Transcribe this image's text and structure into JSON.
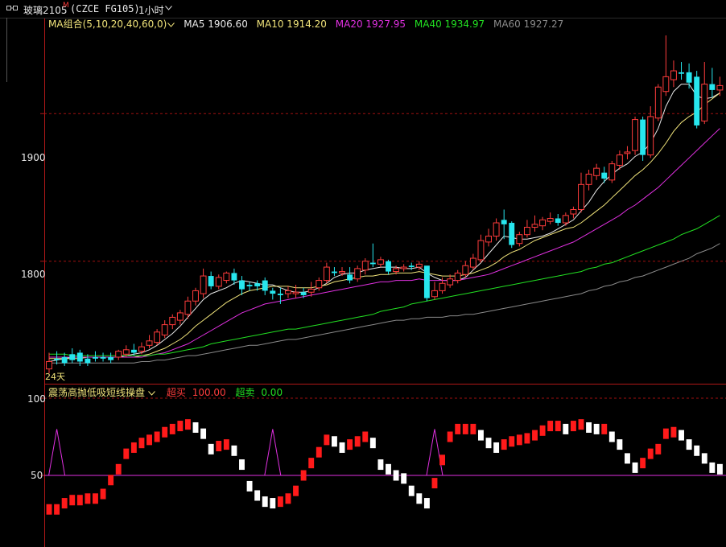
{
  "window": {
    "symbol": "玻璃2105",
    "flag": "M",
    "code": "(CZCE FG105)",
    "period": "1小时"
  },
  "ma_legend": {
    "group_label": "MA组合(5,10,20,40,60,0)",
    "items": [
      {
        "label": "MA5 1906.60",
        "color": "#e8e8e8"
      },
      {
        "label": "MA10 1914.20",
        "color": "#f0e37a"
      },
      {
        "label": "MA20 1927.95",
        "color": "#e030e0"
      },
      {
        "label": "MA40 1934.97",
        "color": "#22e022"
      },
      {
        "label": "MA60 1927.27",
        "color": "#8a8a8a"
      }
    ]
  },
  "price_axis": {
    "labels": [
      "1900",
      "1800"
    ]
  },
  "days_label": "24天",
  "indicator": {
    "name": "震荡高抛低吸短线操盘",
    "overbuy_label": "超买",
    "overbuy_value": "100.00",
    "oversell_label": "超卖",
    "oversell_value": "0.00",
    "axis_labels": [
      "100",
      "50"
    ]
  },
  "colors": {
    "up": "#ff3c3c",
    "down": "#27e6ee",
    "grid": "#a01010",
    "bg": "#000000"
  },
  "chart_data": {
    "type": "candlestick",
    "y_range": [
      1717,
      1965
    ],
    "candles": [
      [
        1727,
        1738,
        1732,
        1724
      ],
      [
        1734,
        1739,
        1733,
        1730
      ],
      [
        1735,
        1738,
        1731,
        1729
      ],
      [
        1737,
        1741,
        1733,
        1731
      ],
      [
        1738,
        1740,
        1732,
        1729
      ],
      [
        1734,
        1737,
        1731,
        1729
      ],
      [
        1735,
        1739,
        1734,
        1732
      ],
      [
        1735,
        1738,
        1734,
        1732
      ],
      [
        1735,
        1738,
        1733,
        1731
      ],
      [
        1735,
        1740,
        1739,
        1733
      ],
      [
        1737,
        1743,
        1740,
        1735
      ],
      [
        1740,
        1744,
        1738,
        1736
      ],
      [
        1739,
        1745,
        1742,
        1737
      ],
      [
        1743,
        1750,
        1746,
        1741
      ],
      [
        1745,
        1754,
        1752,
        1743
      ],
      [
        1750,
        1760,
        1757,
        1748
      ],
      [
        1757,
        1764,
        1762,
        1754
      ],
      [
        1760,
        1767,
        1765,
        1757
      ],
      [
        1764,
        1776,
        1773,
        1761
      ],
      [
        1773,
        1782,
        1780,
        1770
      ],
      [
        1778,
        1795,
        1790,
        1775
      ],
      [
        1790,
        1793,
        1783,
        1781
      ],
      [
        1783,
        1791,
        1789,
        1781
      ],
      [
        1787,
        1793,
        1792,
        1785
      ],
      [
        1792,
        1795,
        1787,
        1784
      ],
      [
        1787,
        1790,
        1781,
        1777
      ],
      [
        1784,
        1786,
        1783,
        1780
      ],
      [
        1785,
        1787,
        1783,
        1780
      ],
      [
        1787,
        1789,
        1780,
        1777
      ],
      [
        1780,
        1782,
        1778,
        1774
      ],
      [
        1778,
        1782,
        1777,
        1771
      ],
      [
        1778,
        1783,
        1780,
        1775
      ],
      [
        1778,
        1784,
        1779,
        1775
      ],
      [
        1779,
        1782,
        1777,
        1775
      ],
      [
        1779,
        1786,
        1781,
        1776
      ],
      [
        1782,
        1789,
        1787,
        1780
      ],
      [
        1787,
        1799,
        1796,
        1785
      ],
      [
        1793,
        1796,
        1792,
        1790
      ],
      [
        1792,
        1796,
        1793,
        1790
      ],
      [
        1791,
        1796,
        1787,
        1785
      ],
      [
        1788,
        1797,
        1795,
        1786
      ],
      [
        1794,
        1802,
        1800,
        1791
      ],
      [
        1799,
        1812,
        1798,
        1796
      ],
      [
        1798,
        1803,
        1801,
        1796
      ],
      [
        1800,
        1801,
        1793,
        1791
      ],
      [
        1793,
        1797,
        1795,
        1791
      ],
      [
        1795,
        1798,
        1796,
        1793
      ],
      [
        1797,
        1799,
        1796,
        1794
      ],
      [
        1796,
        1800,
        1798,
        1794
      ],
      [
        1797,
        1796,
        1775,
        1773
      ],
      [
        1776,
        1786,
        1780,
        1774
      ],
      [
        1780,
        1789,
        1785,
        1778
      ],
      [
        1784,
        1791,
        1788,
        1782
      ],
      [
        1787,
        1794,
        1792,
        1785
      ],
      [
        1791,
        1800,
        1797,
        1789
      ],
      [
        1796,
        1805,
        1802,
        1794
      ],
      [
        1801,
        1818,
        1814,
        1799
      ],
      [
        1813,
        1822,
        1817,
        1810
      ],
      [
        1817,
        1829,
        1826,
        1814
      ],
      [
        1828,
        1835,
        1825,
        1815
      ],
      [
        1826,
        1827,
        1811,
        1809
      ],
      [
        1812,
        1820,
        1818,
        1810
      ],
      [
        1818,
        1828,
        1823,
        1816
      ],
      [
        1823,
        1831,
        1825,
        1820
      ],
      [
        1824,
        1830,
        1828,
        1821
      ],
      [
        1827,
        1833,
        1829,
        1825
      ],
      [
        1829,
        1832,
        1826,
        1824
      ],
      [
        1826,
        1833,
        1831,
        1824
      ],
      [
        1832,
        1837,
        1835,
        1829
      ],
      [
        1835,
        1860,
        1852,
        1833
      ],
      [
        1852,
        1862,
        1859,
        1848
      ],
      [
        1858,
        1866,
        1863,
        1855
      ],
      [
        1860,
        1864,
        1856,
        1853
      ],
      [
        1855,
        1868,
        1866,
        1853
      ],
      [
        1865,
        1875,
        1872,
        1862
      ],
      [
        1873,
        1878,
        1874,
        1869
      ],
      [
        1875,
        1898,
        1896,
        1872
      ],
      [
        1896,
        1898,
        1872,
        1868
      ],
      [
        1872,
        1905,
        1898,
        1870
      ],
      [
        1897,
        1920,
        1918,
        1895
      ],
      [
        1915,
        1953,
        1925,
        1912
      ],
      [
        1923,
        1936,
        1929,
        1918
      ],
      [
        1928,
        1935,
        1927,
        1923
      ],
      [
        1928,
        1934,
        1921,
        1917
      ],
      [
        1925,
        1929,
        1892,
        1890
      ],
      [
        1895,
        1935,
        1920,
        1893
      ],
      [
        1920,
        1931,
        1916,
        1911
      ],
      [
        1916,
        1925,
        1919,
        1912
      ]
    ],
    "ma": {
      "MA5": [
        1732,
        1733,
        1734,
        1735,
        1735,
        1735,
        1735,
        1735,
        1735,
        1735,
        1736,
        1737,
        1738,
        1740,
        1743,
        1747,
        1751,
        1756,
        1762,
        1768,
        1774,
        1778,
        1780,
        1782,
        1785,
        1787,
        1786,
        1785,
        1784,
        1784,
        1782,
        1780,
        1779,
        1779,
        1780,
        1782,
        1785,
        1789,
        1791,
        1792,
        1792,
        1794,
        1795,
        1796,
        1796,
        1796,
        1795,
        1795,
        1796,
        1792,
        1789,
        1787,
        1787,
        1787,
        1789,
        1794,
        1799,
        1805,
        1811,
        1817,
        1816,
        1815,
        1815,
        1816,
        1817,
        1819,
        1822,
        1825,
        1828,
        1834,
        1840,
        1848,
        1854,
        1859,
        1863,
        1866,
        1871,
        1874,
        1880,
        1890,
        1905,
        1915,
        1920,
        1920,
        1912,
        1910,
        1911,
        1914
      ],
      "MA10": [
        1734,
        1734,
        1734,
        1734,
        1734,
        1735,
        1735,
        1735,
        1735,
        1735,
        1735,
        1735,
        1736,
        1737,
        1739,
        1741,
        1744,
        1747,
        1751,
        1756,
        1760,
        1764,
        1768,
        1772,
        1775,
        1778,
        1780,
        1781,
        1782,
        1783,
        1783,
        1783,
        1782,
        1782,
        1782,
        1783,
        1784,
        1786,
        1787,
        1788,
        1789,
        1790,
        1790,
        1791,
        1791,
        1792,
        1792,
        1792,
        1793,
        1792,
        1791,
        1790,
        1790,
        1790,
        1791,
        1792,
        1794,
        1796,
        1799,
        1803,
        1806,
        1808,
        1811,
        1814,
        1816,
        1818,
        1820,
        1822,
        1823,
        1826,
        1830,
        1834,
        1838,
        1843,
        1848,
        1853,
        1858,
        1862,
        1867,
        1873,
        1880,
        1888,
        1894,
        1898,
        1901,
        1906,
        1910,
        1914
      ],
      "MA20": [
        1735,
        1735,
        1735,
        1735,
        1735,
        1735,
        1735,
        1735,
        1735,
        1735,
        1735,
        1735,
        1735,
        1736,
        1737,
        1738,
        1740,
        1742,
        1744,
        1747,
        1750,
        1753,
        1756,
        1759,
        1762,
        1765,
        1767,
        1769,
        1771,
        1772,
        1773,
        1774,
        1775,
        1776,
        1777,
        1778,
        1779,
        1780,
        1781,
        1782,
        1783,
        1784,
        1785,
        1786,
        1786,
        1787,
        1787,
        1787,
        1788,
        1787,
        1787,
        1787,
        1787,
        1787,
        1788,
        1789,
        1790,
        1791,
        1793,
        1795,
        1797,
        1799,
        1801,
        1803,
        1805,
        1807,
        1809,
        1811,
        1813,
        1816,
        1819,
        1822,
        1825,
        1828,
        1831,
        1835,
        1838,
        1842,
        1846,
        1850,
        1855,
        1860,
        1865,
        1870,
        1875,
        1880,
        1885,
        1890
      ],
      "MA40": [
        1737,
        1737,
        1737,
        1736,
        1736,
        1736,
        1736,
        1736,
        1736,
        1736,
        1736,
        1736,
        1736,
        1736,
        1737,
        1737,
        1738,
        1739,
        1740,
        1741,
        1742,
        1744,
        1745,
        1746,
        1747,
        1748,
        1749,
        1750,
        1751,
        1752,
        1753,
        1754,
        1754,
        1755,
        1756,
        1757,
        1758,
        1759,
        1760,
        1761,
        1762,
        1763,
        1764,
        1766,
        1767,
        1768,
        1769,
        1771,
        1772,
        1773,
        1774,
        1775,
        1776,
        1777,
        1778,
        1779,
        1780,
        1781,
        1782,
        1783,
        1784,
        1785,
        1786,
        1787,
        1788,
        1789,
        1790,
        1791,
        1792,
        1793,
        1795,
        1796,
        1798,
        1799,
        1801,
        1803,
        1805,
        1807,
        1809,
        1811,
        1813,
        1815,
        1818,
        1820,
        1822,
        1825,
        1828,
        1831
      ],
      "MA60": [
        1731,
        1731,
        1731,
        1731,
        1731,
        1731,
        1731,
        1731,
        1731,
        1731,
        1731,
        1731,
        1732,
        1732,
        1733,
        1733,
        1734,
        1735,
        1736,
        1736,
        1737,
        1738,
        1739,
        1740,
        1741,
        1742,
        1743,
        1743,
        1744,
        1745,
        1746,
        1747,
        1747,
        1748,
        1749,
        1750,
        1751,
        1752,
        1753,
        1754,
        1755,
        1756,
        1757,
        1758,
        1759,
        1760,
        1760,
        1761,
        1761,
        1762,
        1762,
        1762,
        1763,
        1763,
        1764,
        1764,
        1765,
        1766,
        1767,
        1768,
        1769,
        1770,
        1771,
        1772,
        1773,
        1774,
        1775,
        1776,
        1777,
        1778,
        1780,
        1781,
        1783,
        1784,
        1786,
        1787,
        1789,
        1790,
        1792,
        1794,
        1796,
        1798,
        1800,
        1802,
        1805,
        1807,
        1809,
        1812
      ]
    },
    "oscillator": {
      "y_range": [
        20,
        100
      ],
      "baseline": 50,
      "values": [
        28,
        28,
        32,
        34,
        34,
        35,
        35,
        38,
        47,
        54,
        64,
        68,
        71,
        73,
        75,
        78,
        80,
        82,
        83,
        81,
        77,
        67,
        69,
        70,
        66,
        57,
        43,
        37,
        33,
        32,
        33,
        35,
        40,
        50,
        58,
        65,
        73,
        72,
        68,
        70,
        72,
        75,
        71,
        57,
        54,
        50,
        48,
        40,
        35,
        32,
        45,
        60,
        75,
        80,
        80,
        80,
        76,
        71,
        68,
        70,
        72,
        73,
        74,
        76,
        79,
        82,
        82,
        80,
        82,
        83,
        81,
        80,
        80,
        75,
        70,
        61,
        55,
        58,
        64,
        67,
        77,
        78,
        76,
        70,
        66,
        61,
        55,
        54
      ],
      "markers": [
        1,
        29,
        50
      ]
    }
  }
}
